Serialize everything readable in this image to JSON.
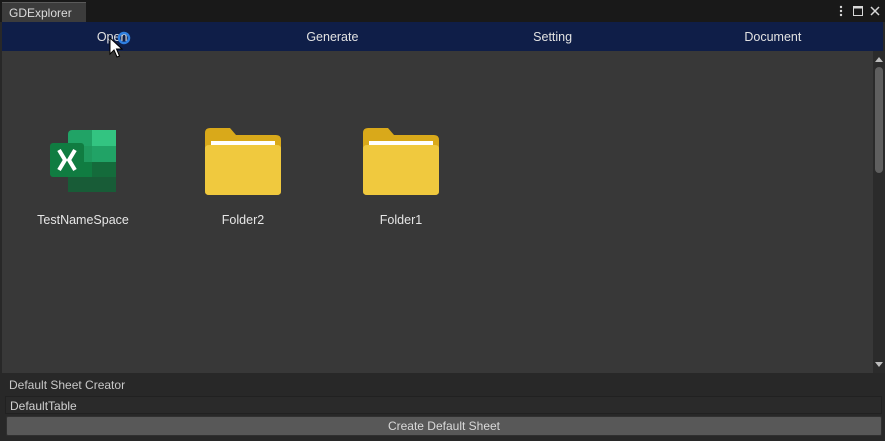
{
  "window": {
    "tab_title": "GDExplorer",
    "buttons": [
      "more-icon",
      "maximize-icon",
      "close-icon"
    ]
  },
  "menu": {
    "items": [
      {
        "label": "Open"
      },
      {
        "label": "Generate"
      },
      {
        "label": "Setting"
      },
      {
        "label": "Document"
      }
    ]
  },
  "explorer": {
    "items": [
      {
        "label": "TestNameSpace",
        "icon": "excel-file-icon"
      },
      {
        "label": "Folder2",
        "icon": "folder-icon"
      },
      {
        "label": "Folder1",
        "icon": "folder-icon"
      }
    ]
  },
  "creator": {
    "section_label": "Default Sheet Creator",
    "table_name_value": "DefaultTable",
    "create_button_label": "Create Default Sheet"
  },
  "colors": {
    "menu_bar": "#0f1e48",
    "panel_bg": "#383838",
    "folder": "#e8c23c",
    "excel": "#1d6f42"
  }
}
